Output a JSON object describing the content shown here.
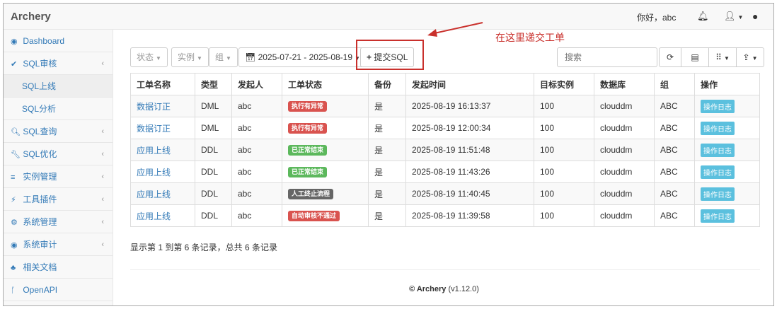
{
  "header": {
    "brand": "Archery",
    "greeting": "你好，abc"
  },
  "sidebar": {
    "items": [
      {
        "label": "Dashboard",
        "icon": "tachometer-icon",
        "glyph": "◉"
      },
      {
        "label": "SQL审核",
        "icon": "check-icon",
        "glyph": "✔",
        "chev": "‹"
      },
      {
        "label": "SQL上线",
        "sub": true,
        "active": true
      },
      {
        "label": "SQL分析",
        "sub": true
      },
      {
        "label": "SQL查询",
        "icon": "search-icon",
        "glyph": "🔍︎",
        "chev": "‹"
      },
      {
        "label": "SQL优化",
        "icon": "wrench-icon",
        "glyph": "🔧︎",
        "chev": "‹"
      },
      {
        "label": "实例管理",
        "icon": "database-icon",
        "glyph": "≡",
        "chev": "‹"
      },
      {
        "label": "工具插件",
        "icon": "plug-icon",
        "glyph": "⚡︎",
        "chev": "‹"
      },
      {
        "label": "系统管理",
        "icon": "cogs-icon",
        "glyph": "⚙︎",
        "chev": "‹"
      },
      {
        "label": "系统审计",
        "icon": "eye-icon",
        "glyph": "◉",
        "chev": "‹"
      },
      {
        "label": "相关文档",
        "icon": "sitemap-icon",
        "glyph": "♣︎"
      },
      {
        "label": "OpenAPI",
        "icon": "code-fork-icon",
        "glyph": "ᚴ"
      }
    ]
  },
  "toolbar": {
    "status": "状态",
    "instance": "实例",
    "group": "组",
    "date_range": "2025-07-21 - 2025-08-19",
    "submit": "提交SQL",
    "search_placeholder": "搜索"
  },
  "annotation": {
    "text": "在这里递交工单"
  },
  "table": {
    "columns": [
      "工单名称",
      "类型",
      "发起人",
      "工单状态",
      "备份",
      "发起时间",
      "目标实例",
      "数据库",
      "组",
      "操作"
    ],
    "rows": [
      {
        "name": "数据订正",
        "type": "DML",
        "user": "abc",
        "status": "执行有异常",
        "status_color": "#d9534f",
        "backup": "是",
        "time": "2025-08-19 16:13:37",
        "instance": "100",
        "db": "clouddm",
        "group": "ABC",
        "op": "操作日志"
      },
      {
        "name": "数据订正",
        "type": "DML",
        "user": "abc",
        "status": "执行有异常",
        "status_color": "#d9534f",
        "backup": "是",
        "time": "2025-08-19 12:00:34",
        "instance": "100",
        "db": "clouddm",
        "group": "ABC",
        "op": "操作日志"
      },
      {
        "name": "应用上线",
        "type": "DDL",
        "user": "abc",
        "status": "已正常结束",
        "status_color": "#5cb85c",
        "backup": "是",
        "time": "2025-08-19 11:51:48",
        "instance": "100",
        "db": "clouddm",
        "group": "ABC",
        "op": "操作日志"
      },
      {
        "name": "应用上线",
        "type": "DDL",
        "user": "abc",
        "status": "已正常结束",
        "status_color": "#5cb85c",
        "backup": "是",
        "time": "2025-08-19 11:43:26",
        "instance": "100",
        "db": "clouddm",
        "group": "ABC",
        "op": "操作日志"
      },
      {
        "name": "应用上线",
        "type": "DDL",
        "user": "abc",
        "status": "人工终止流程",
        "status_color": "#666666",
        "backup": "是",
        "time": "2025-08-19 11:40:45",
        "instance": "100",
        "db": "clouddm",
        "group": "ABC",
        "op": "操作日志"
      },
      {
        "name": "应用上线",
        "type": "DDL",
        "user": "abc",
        "status": "自动审核不通过",
        "status_color": "#d9534f",
        "backup": "是",
        "time": "2025-08-19 11:39:58",
        "instance": "100",
        "db": "clouddm",
        "group": "ABC",
        "op": "操作日志"
      }
    ]
  },
  "summary": "显示第 1 到第 6 条记录，总共 6 条记录",
  "footer": {
    "copyright": "© Archery",
    "version": "(v1.12.0)"
  }
}
